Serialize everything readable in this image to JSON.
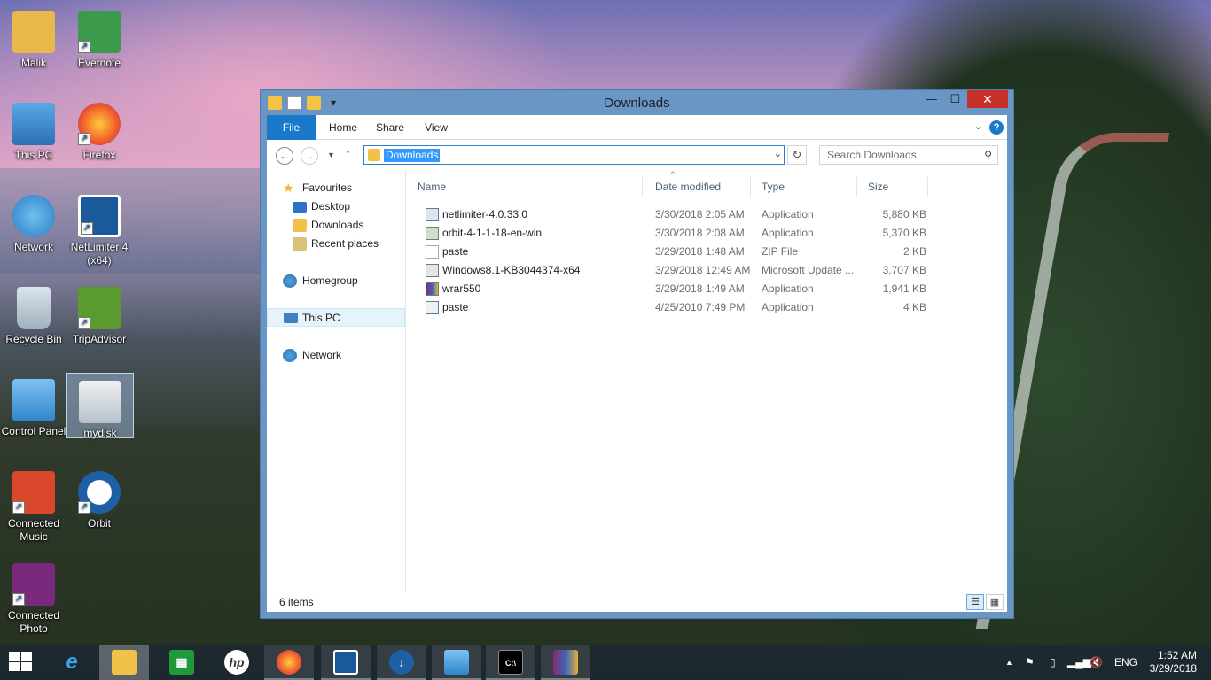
{
  "desktop": {
    "icons": [
      {
        "label": "Malik"
      },
      {
        "label": "Evernote"
      },
      {
        "label": "This PC"
      },
      {
        "label": "Firefox"
      },
      {
        "label": "Network"
      },
      {
        "label": "NetLimiter 4 (x64)"
      },
      {
        "label": "Recycle Bin"
      },
      {
        "label": "TripAdvisor"
      },
      {
        "label": "Control Panel"
      },
      {
        "label": "mydisk"
      },
      {
        "label": "Connected Music"
      },
      {
        "label": "Orbit"
      },
      {
        "label": "Connected Photo"
      }
    ]
  },
  "window": {
    "title": "Downloads",
    "ribbon_tabs": [
      "File",
      "Home",
      "Share",
      "View"
    ],
    "help": "?",
    "address": "Downloads",
    "search_placeholder": "Search Downloads",
    "nav": {
      "favourites": "Favourites",
      "desktop": "Desktop",
      "downloads": "Downloads",
      "recent": "Recent places",
      "homegroup": "Homegroup",
      "thispc": "This PC",
      "network": "Network"
    },
    "columns": {
      "name": "Name",
      "date": "Date modified",
      "type": "Type",
      "size": "Size"
    },
    "files": [
      {
        "name": "netlimiter-4.0.33.0",
        "date": "3/30/2018 2:05 AM",
        "type": "Application",
        "size": "5,880 KB"
      },
      {
        "name": "orbit-4-1-1-18-en-win",
        "date": "3/30/2018 2:08 AM",
        "type": "Application",
        "size": "5,370 KB"
      },
      {
        "name": "paste",
        "date": "3/29/2018 1:48 AM",
        "type": "ZIP File",
        "size": "2 KB"
      },
      {
        "name": "Windows8.1-KB3044374-x64",
        "date": "3/29/2018 12:49 AM",
        "type": "Microsoft Update ...",
        "size": "3,707 KB"
      },
      {
        "name": "wrar550",
        "date": "3/29/2018 1:49 AM",
        "type": "Application",
        "size": "1,941 KB"
      },
      {
        "name": "paste",
        "date": "4/25/2010 7:49 PM",
        "type": "Application",
        "size": "4 KB"
      }
    ],
    "status": "6 items"
  },
  "taskbar": {
    "apps": [
      "internet-explorer",
      "file-explorer",
      "store",
      "hp",
      "firefox",
      "netlimiter",
      "orbit",
      "control-panel",
      "command-prompt",
      "winrar"
    ],
    "language": "ENG",
    "time": "1:52 AM",
    "date": "3/29/2018"
  }
}
